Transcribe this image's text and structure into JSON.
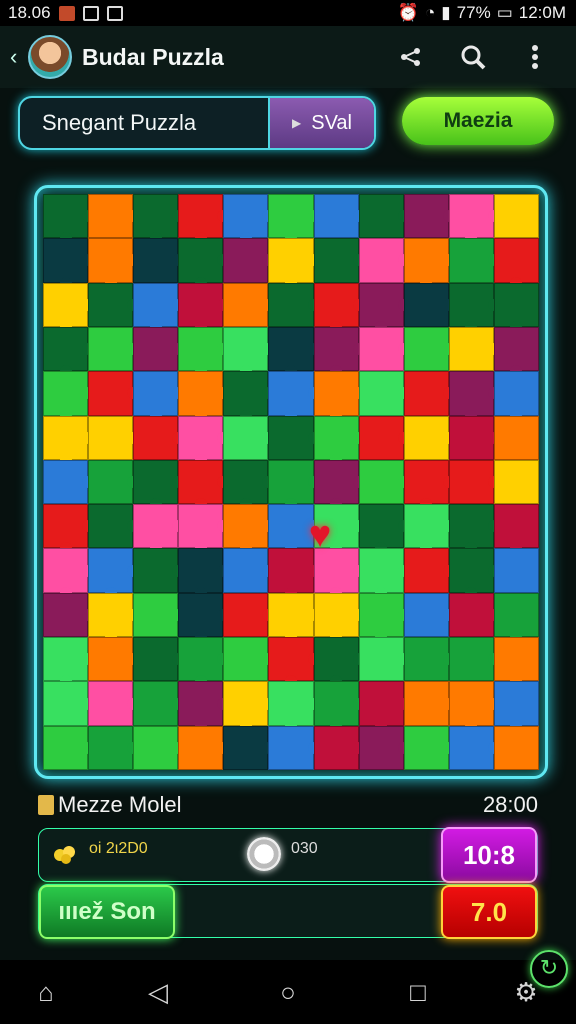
{
  "status_bar": {
    "time_left": "18.06",
    "battery": "77%",
    "time_right": "12:0M",
    "icons": [
      "notification-icon",
      "image-icon",
      "screenshot-icon",
      "alarm-icon",
      "wifi-icon",
      "signal-icon"
    ]
  },
  "app_bar": {
    "title": "Budaı Puzzla",
    "actions": [
      "share-icon",
      "search-icon",
      "more-vert-icon"
    ]
  },
  "controls": {
    "search_text": "Snegant Puzzla",
    "select_value": "SVal",
    "primary_button": "Maezia"
  },
  "board": {
    "rows": 13,
    "cols": 11,
    "colors": [
      "#e61b1b",
      "#ff7a00",
      "#ffd000",
      "#2ecc40",
      "#17a23a",
      "#0b6a2e",
      "#ff4fa3",
      "#2b7bd8",
      "#8a1b5a",
      "#c0103a",
      "#38e060",
      "#0a3a42"
    ]
  },
  "info": {
    "mode_label": "Mezze Molel",
    "timer": "28:00",
    "coins_value": "oi 2ι2D0",
    "slider_value": "030",
    "badge_purple": "10:8",
    "green_button": "ıııež Son",
    "badge_red": "7.0"
  },
  "nav": {
    "items": [
      "home-icon",
      "back-icon",
      "recents-home-icon",
      "recents-icon",
      "settings-icon"
    ]
  }
}
